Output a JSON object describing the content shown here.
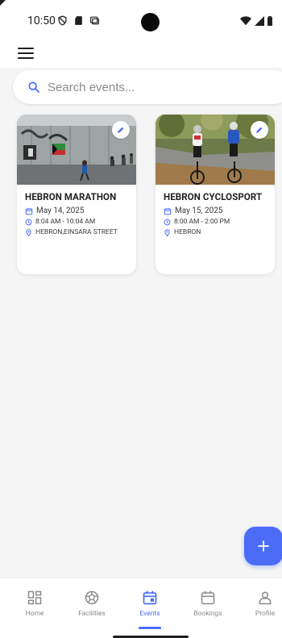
{
  "status_bar": {
    "time": "10:50"
  },
  "search": {
    "placeholder": "Search events..."
  },
  "events": [
    {
      "title": "HEBRON MARATHON",
      "date": "May 14, 2025",
      "time": "8:04 AM - 10:04 AM",
      "location": "HEBRON,EINSARA STREET"
    },
    {
      "title": "HEBRON CYCLOSPORT",
      "date": "May 15, 2025",
      "time": "8:00 AM - 2:00 PM",
      "location": "HEBRON"
    }
  ],
  "nav": {
    "items": [
      {
        "label": "Home",
        "icon": "grid-icon"
      },
      {
        "label": "Facilities",
        "icon": "ball-icon"
      },
      {
        "label": "Events",
        "icon": "calendar-event-icon"
      },
      {
        "label": "Bookings",
        "icon": "calendar-icon"
      },
      {
        "label": "Profile",
        "icon": "person-icon"
      }
    ],
    "active": "Events"
  },
  "colors": {
    "accent": "#4a6cf7",
    "background": "#f5f5f5",
    "card": "#ffffff",
    "text": "#1f1f1f"
  }
}
